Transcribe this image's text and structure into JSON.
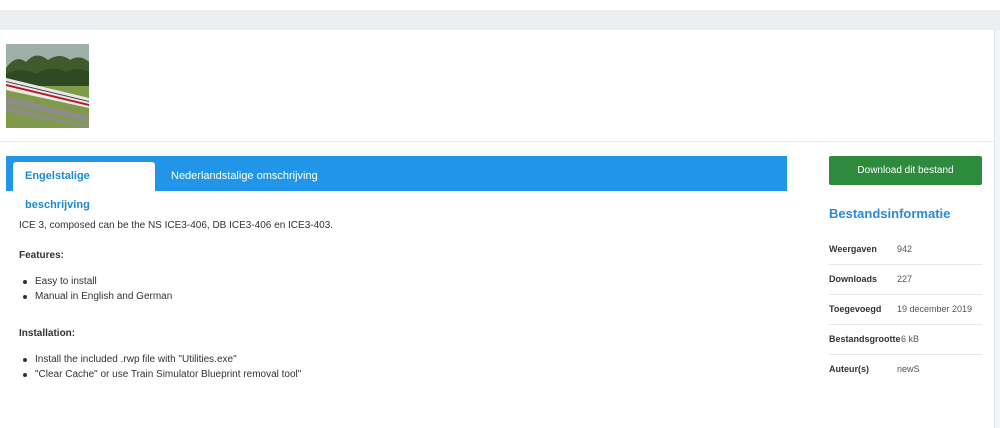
{
  "image": {
    "alt_icon": "train-thumbnail"
  },
  "tabs": [
    {
      "label": "Engelstalige beschrijving",
      "active": true
    },
    {
      "label": "Nederlandstalige omschrijving",
      "active": false
    }
  ],
  "content": {
    "intro": "ICE 3, composed can be the NS ICE3-406, DB ICE3-406 en ICE3-403.",
    "features_heading": "Features:",
    "features": [
      "Easy to install",
      "Manual in English and German"
    ],
    "installation_heading": "Installation:",
    "installation": [
      "Install the included .rwp file with \"Utilities.exe\"",
      "\"Clear Cache\" or use Train Simulator Blueprint removal tool\""
    ]
  },
  "sidebar": {
    "download_label": "Download dit bestand",
    "info_title": "Bestandsinformatie",
    "rows": [
      {
        "key": "Weergaven",
        "value": "942"
      },
      {
        "key": "Downloads",
        "value": "227"
      },
      {
        "key": "Toegevoegd",
        "value": "19 december 2019"
      },
      {
        "key": "Bestandsgrootte",
        "value": "6 kB"
      },
      {
        "key": "Auteur(s)",
        "value": "newS"
      }
    ]
  },
  "colors": {
    "tab_bar": "#2196e8",
    "download": "#2e8b3e",
    "info_title": "#2a8ad6"
  }
}
